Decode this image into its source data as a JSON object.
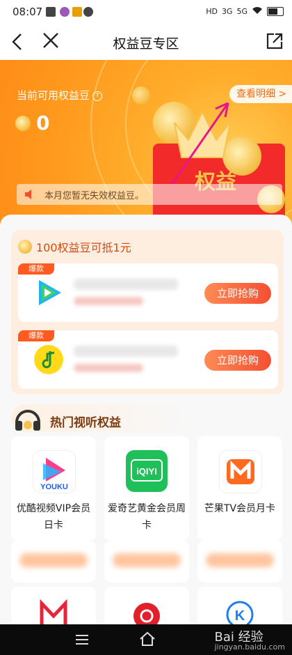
{
  "status": {
    "time": "08:07",
    "network_a": "HD",
    "network_b": "5G",
    "signal1": "3G"
  },
  "nav": {
    "title": "权益豆专区"
  },
  "banner": {
    "label": "当前可用权益豆",
    "points": "0",
    "detail_link": "查看明细 >",
    "envelope_text": "权益",
    "notice": "本月您暂无失效权益豆。"
  },
  "promo": {
    "title": "100权益豆可抵1元",
    "cards": [
      {
        "badge": "爆款",
        "button": "立即抢购"
      },
      {
        "badge": "爆款",
        "button": "立即抢购"
      }
    ]
  },
  "hot": {
    "title": "热门视听权益",
    "items": [
      {
        "name": "优酷视频VIP会员日卡",
        "logo_text": "YOUKU",
        "color": "#ff3e8a"
      },
      {
        "name": "爱奇艺黄金会员周卡",
        "logo_text": "iQIYI",
        "color": "#1fc05a"
      },
      {
        "name": "芒果TV会员月卡",
        "logo_text": "M",
        "color": "#ff6a1f"
      }
    ]
  },
  "watermark": {
    "main": "Bai 经验",
    "sub": "jingyan.baidu.com"
  },
  "colors": {
    "accent": "#ff8c17",
    "button": "#f44f32",
    "envelope": "#f32a2a"
  }
}
